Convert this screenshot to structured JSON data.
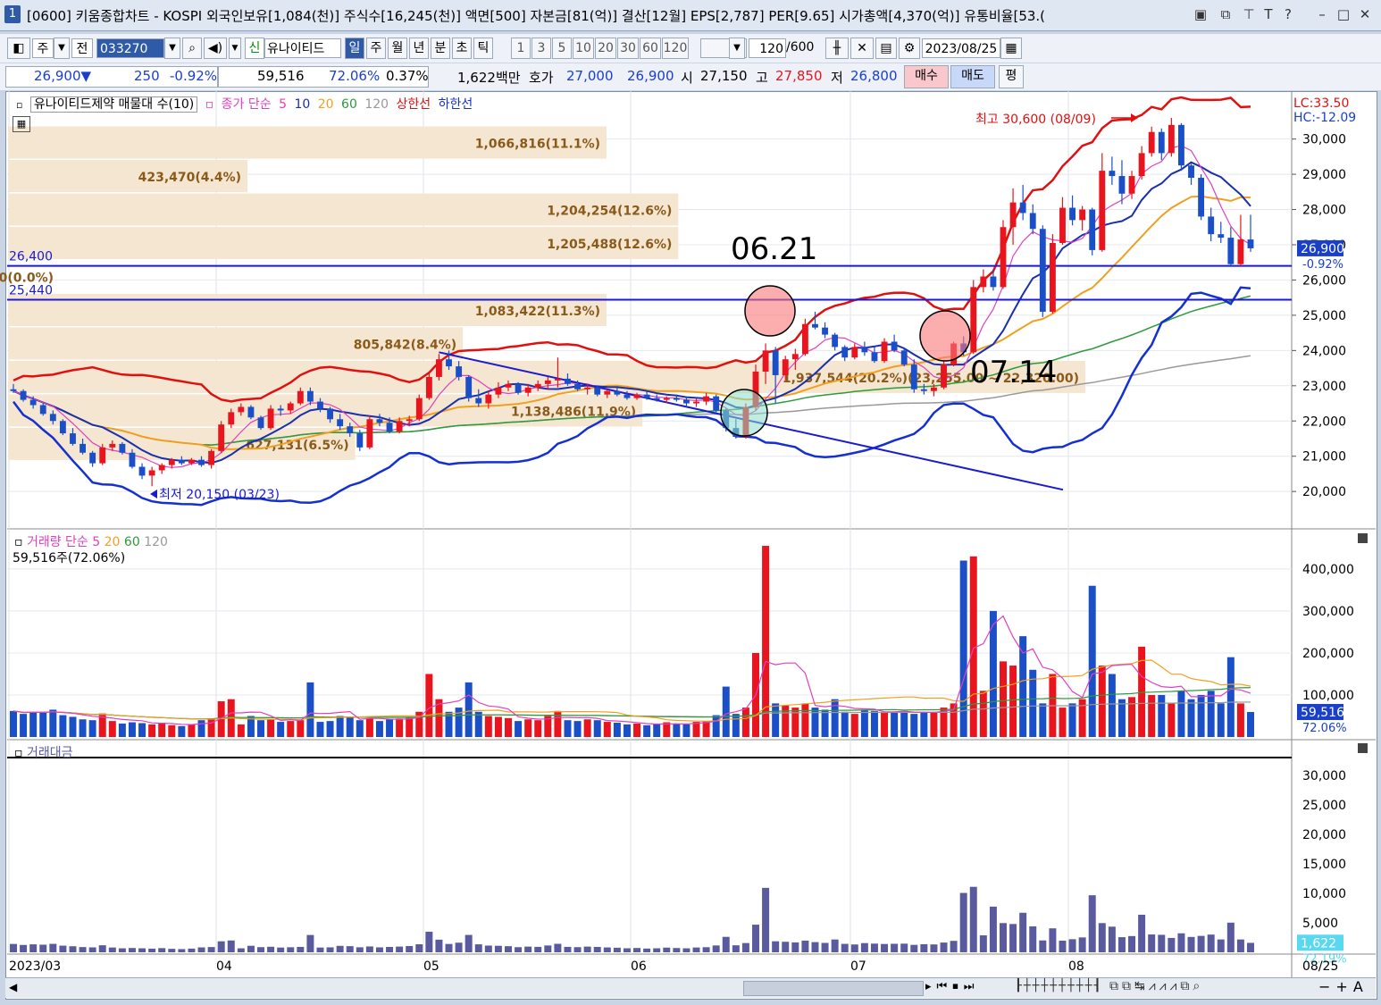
{
  "window": {
    "number": "1",
    "title": "[0600] 키움종합차트 - KOSPI 외국인보유[1,084(천)] 주식수[16,245(천)] 액면[500] 자본금[81(억)] 결산[12월] EPS[2,787] PER[9.65] 시가총액[4,370(억)] 유통비율[53.("
  },
  "toolbar": {
    "market": "주",
    "mode": "전",
    "code": "033270",
    "stock_badge": "신",
    "stock_name": "유나이티드",
    "periods": [
      "일",
      "주",
      "월",
      "년",
      "분",
      "초",
      "틱"
    ],
    "active_period": "일",
    "intervals": [
      "1",
      "3",
      "5",
      "10",
      "20",
      "30",
      "60",
      "120"
    ],
    "count": "120",
    "count_max": "/600",
    "date": "2023/08/25"
  },
  "quote": {
    "price": "26,900▼",
    "change": "250",
    "change_pct": "-0.92%",
    "volume": "59,516",
    "volume_ratio": "72.06%",
    "turnover": "0.37%",
    "amount": "1,622백만",
    "bid_label": "호가",
    "ask": "27,000",
    "bid": "26,900",
    "open_label": "시",
    "open": "27,150",
    "high_label": "고",
    "high": "27,850",
    "low_label": "저",
    "low": "26,800",
    "buy_label": "매수",
    "sell_label": "매도",
    "eval_label": "평"
  },
  "legend": {
    "price": {
      "title": "유나이티드제약 매물대 수(10)",
      "ma_label": "종가 단순",
      "ma_periods": [
        "5",
        "10",
        "20",
        "60",
        "120"
      ],
      "upper": "상한선",
      "lower": "하한선"
    },
    "volume": {
      "title": "거래량",
      "ma_label": "단순",
      "ma_periods": [
        "5",
        "20",
        "60",
        "120"
      ],
      "current": "59,516주(72.06%)"
    },
    "amount": {
      "title": "거래대금"
    }
  },
  "annotations": {
    "high": "최고 30,600 (08/09)",
    "low": "최저 20,150 (03/23)",
    "date1": "06.21",
    "date2": "07.14",
    "lc": "LC:33.50",
    "hc": "HC:-12.09"
  },
  "colors": {
    "up": "#e8141e",
    "down": "#1a4fc8",
    "ma5": "#e040c0",
    "ma10": "#1a2fb0",
    "ma20": "#f0a020",
    "ma60": "#2e9a3a",
    "ma120": "#999999",
    "upper": "#e01010",
    "lower": "#1530d0",
    "profile": "#f5e6d2",
    "amount_bar": "#5a5a9e"
  },
  "chart_data": [
    {
      "type": "candlestick",
      "title": "유나이티드제약 일봉",
      "ylim": [
        19700,
        30700
      ],
      "y_ticks": [
        "30,000",
        "29,000",
        "28,000",
        "27,000",
        "26,000",
        "25,000",
        "24,000",
        "23,000",
        "22,000",
        "21,000",
        "20,000"
      ],
      "x_ticks": [
        "2023/03",
        "04",
        "05",
        "06",
        "07",
        "08",
        "08/25"
      ],
      "last_price": "26,900",
      "last_change_pct": "-0.92%",
      "horizontal_lines": [
        {
          "label": "26,400",
          "value": 26400
        },
        {
          "label": "25,440",
          "value": 25440
        }
      ],
      "volume_profile": [
        {
          "label": "1,066,816(11.1%)",
          "price": 29.9,
          "width": 0.5
        },
        {
          "label": "423,470(4.4%)",
          "price": 28.95,
          "width": 0.2
        },
        {
          "label": "1,204,254(12.6%)",
          "price": 28.0,
          "width": 0.56
        },
        {
          "label": "1,205,488(12.6%)",
          "price": 27.05,
          "width": 0.56
        },
        {
          "label": "0(0.0%)",
          "price": 26.1,
          "width": 0.0
        },
        {
          "label": "1,083,422(11.3%)",
          "price": 25.15,
          "width": 0.5
        },
        {
          "label": "805,842(8.4%)",
          "price": 24.2,
          "width": 0.38
        },
        {
          "label": "1,937,544(20.2%)(23,255.00 ~ 22,320.00)",
          "price": 23.25,
          "width": 0.9
        },
        {
          "label": "1,138,486(11.9%)",
          "price": 22.3,
          "width": 0.53
        },
        {
          "label": "627,131(6.5%)",
          "price": 21.35,
          "width": 0.29
        }
      ],
      "candles": [
        [
          22900,
          23050,
          22800,
          22850
        ],
        [
          22850,
          22900,
          22550,
          22600
        ],
        [
          22600,
          22700,
          22350,
          22450
        ],
        [
          22450,
          22500,
          22150,
          22200
        ],
        [
          22200,
          22300,
          21900,
          22000
        ],
        [
          22000,
          22050,
          21600,
          21650
        ],
        [
          21650,
          21800,
          21300,
          21350
        ],
        [
          21350,
          21500,
          21050,
          21100
        ],
        [
          21100,
          21150,
          20700,
          20800
        ],
        [
          20800,
          21350,
          20750,
          21250
        ],
        [
          21250,
          21450,
          21150,
          21350
        ],
        [
          21350,
          21400,
          21050,
          21100
        ],
        [
          21100,
          21200,
          20650,
          20700
        ],
        [
          20700,
          20800,
          20350,
          20450
        ],
        [
          20450,
          20700,
          20150,
          20600
        ],
        [
          20600,
          20800,
          20500,
          20750
        ],
        [
          20750,
          20950,
          20650,
          20900
        ],
        [
          20900,
          21000,
          20750,
          20800
        ],
        [
          20800,
          20950,
          20750,
          20900
        ],
        [
          20900,
          21000,
          20700,
          20750
        ],
        [
          20750,
          21200,
          20650,
          21150
        ],
        [
          21150,
          22000,
          21100,
          21900
        ],
        [
          21900,
          22350,
          21800,
          22250
        ],
        [
          22250,
          22500,
          22150,
          22400
        ],
        [
          22400,
          22450,
          22050,
          22100
        ],
        [
          22100,
          22150,
          21750,
          21800
        ],
        [
          21800,
          22450,
          21750,
          22350
        ],
        [
          22350,
          22450,
          22150,
          22300
        ],
        [
          22300,
          22550,
          22200,
          22500
        ],
        [
          22500,
          22950,
          22450,
          22850
        ],
        [
          22850,
          22950,
          22450,
          22550
        ],
        [
          22550,
          22650,
          22250,
          22350
        ],
        [
          22350,
          22400,
          21950,
          22050
        ],
        [
          22050,
          22200,
          21750,
          21850
        ],
        [
          21850,
          21950,
          21550,
          21650
        ],
        [
          21650,
          21750,
          21150,
          21250
        ],
        [
          21250,
          22150,
          21200,
          22050
        ],
        [
          22050,
          22200,
          21850,
          21950
        ],
        [
          21950,
          22100,
          21650,
          21700
        ],
        [
          21700,
          22100,
          21650,
          22000
        ],
        [
          22000,
          22150,
          21850,
          22050
        ],
        [
          22050,
          22750,
          22000,
          22650
        ],
        [
          22650,
          23400,
          22600,
          23250
        ],
        [
          23250,
          23900,
          23150,
          23750
        ],
        [
          23750,
          24000,
          23450,
          23550
        ],
        [
          23550,
          23700,
          23150,
          23250
        ],
        [
          23250,
          23300,
          22550,
          22650
        ],
        [
          22650,
          22900,
          22400,
          22500
        ],
        [
          22500,
          22850,
          22350,
          22750
        ],
        [
          22750,
          23100,
          22650,
          22950
        ],
        [
          22950,
          23150,
          22850,
          23050
        ],
        [
          23050,
          23100,
          22750,
          22800
        ],
        [
          22800,
          23050,
          22700,
          22950
        ],
        [
          22950,
          23150,
          22850,
          23050
        ],
        [
          23050,
          23250,
          22900,
          23150
        ],
        [
          23150,
          23800,
          22950,
          23200
        ],
        [
          23200,
          23350,
          23000,
          23050
        ],
        [
          23050,
          23150,
          22850,
          22900
        ],
        [
          22900,
          23050,
          22750,
          22950
        ],
        [
          22950,
          23000,
          22700,
          22750
        ],
        [
          22750,
          22900,
          22650,
          22850
        ],
        [
          22850,
          22950,
          22700,
          22750
        ],
        [
          22750,
          22850,
          22600,
          22650
        ],
        [
          22650,
          22800,
          22600,
          22750
        ],
        [
          22750,
          22850,
          22600,
          22650
        ],
        [
          22650,
          22750,
          22550,
          22600
        ],
        [
          22600,
          22700,
          22500,
          22650
        ],
        [
          22650,
          22750,
          22550,
          22600
        ],
        [
          22600,
          22700,
          22400,
          22500
        ],
        [
          22500,
          22650,
          22400,
          22550
        ],
        [
          22550,
          22800,
          22450,
          22700
        ],
        [
          22700,
          22750,
          22250,
          22300
        ],
        [
          22300,
          22350,
          21700,
          21800
        ],
        [
          21800,
          22050,
          21500,
          21550
        ],
        [
          21550,
          22500,
          21500,
          22400
        ],
        [
          22400,
          23600,
          22300,
          23400
        ],
        [
          23400,
          24200,
          23050,
          24000
        ],
        [
          24000,
          24100,
          22500,
          23300
        ],
        [
          23300,
          23850,
          23150,
          23750
        ],
        [
          23750,
          24050,
          23450,
          23900
        ],
        [
          23900,
          24900,
          23850,
          24750
        ],
        [
          24750,
          25100,
          24600,
          24650
        ],
        [
          24650,
          24800,
          24350,
          24450
        ],
        [
          24450,
          24500,
          24000,
          24100
        ],
        [
          24100,
          24150,
          23700,
          23800
        ],
        [
          23800,
          24200,
          23750,
          24100
        ],
        [
          24100,
          24250,
          23850,
          23950
        ],
        [
          23950,
          24100,
          23650,
          23700
        ],
        [
          23700,
          24350,
          23650,
          24250
        ],
        [
          24250,
          24450,
          23950,
          24000
        ],
        [
          24000,
          24050,
          23550,
          23600
        ],
        [
          23600,
          23750,
          22800,
          22900
        ],
        [
          22900,
          23050,
          22750,
          22850
        ],
        [
          22850,
          23050,
          22700,
          22950
        ],
        [
          22950,
          23700,
          22900,
          23600
        ],
        [
          23600,
          24250,
          23550,
          24200
        ],
        [
          24200,
          24400,
          23850,
          23950
        ],
        [
          23950,
          26000,
          23900,
          25800
        ],
        [
          25800,
          26300,
          25650,
          26100
        ],
        [
          26100,
          26300,
          25700,
          25800
        ],
        [
          25800,
          27700,
          25750,
          27500
        ],
        [
          27500,
          28600,
          27000,
          28200
        ],
        [
          28200,
          28700,
          27700,
          27900
        ],
        [
          27900,
          28150,
          27300,
          27450
        ],
        [
          27450,
          27550,
          24950,
          25100
        ],
        [
          25100,
          27300,
          25050,
          27050
        ],
        [
          27050,
          28350,
          27000,
          28050
        ],
        [
          28050,
          28400,
          27550,
          27700
        ],
        [
          27700,
          28100,
          27400,
          28000
        ],
        [
          28000,
          28050,
          26700,
          26850
        ],
        [
          26850,
          29600,
          26800,
          29100
        ],
        [
          29100,
          29500,
          28700,
          28950
        ],
        [
          28950,
          29400,
          28150,
          28450
        ],
        [
          28450,
          29100,
          28300,
          28950
        ],
        [
          28950,
          29800,
          28850,
          29600
        ],
        [
          29600,
          30350,
          29500,
          30200
        ],
        [
          30200,
          30300,
          29400,
          29600
        ],
        [
          29600,
          30600,
          29500,
          30400
        ],
        [
          30400,
          30450,
          29100,
          29250
        ],
        [
          29250,
          29300,
          28700,
          28900
        ],
        [
          28900,
          29000,
          27700,
          27800
        ],
        [
          27800,
          28050,
          27100,
          27300
        ],
        [
          27300,
          27650,
          27050,
          27200
        ],
        [
          27200,
          27500,
          26400,
          26450
        ],
        [
          26450,
          27850,
          26400,
          27150
        ],
        [
          27150,
          27850,
          26800,
          26900
        ]
      ]
    },
    {
      "type": "bar",
      "title": "거래량",
      "ylim": [
        0,
        470000
      ],
      "y_ticks": [
        "400,000",
        "300,000",
        "200,000",
        "100,000"
      ],
      "last": "59,516",
      "last_pct": "72.06%",
      "values": [
        62000,
        55000,
        60000,
        58000,
        65000,
        52000,
        48000,
        42000,
        40000,
        56000,
        38000,
        32000,
        35000,
        33000,
        30000,
        34000,
        28000,
        26000,
        30000,
        40000,
        42000,
        85000,
        90000,
        30000,
        50000,
        40000,
        42000,
        36000,
        38000,
        40000,
        130000,
        36000,
        38000,
        50000,
        48000,
        40000,
        45000,
        38000,
        42000,
        44000,
        48000,
        60000,
        150000,
        90000,
        60000,
        70000,
        130000,
        60000,
        50000,
        48000,
        45000,
        38000,
        42000,
        40000,
        50000,
        62000,
        40000,
        38000,
        42000,
        40000,
        36000,
        34000,
        30000,
        32000,
        28000,
        30000,
        35000,
        32000,
        30000,
        36000,
        38000,
        52000,
        120000,
        55000,
        70000,
        200000,
        455000,
        80000,
        75000,
        70000,
        80000,
        70000,
        65000,
        90000,
        60000,
        55000,
        65000,
        62000,
        58000,
        60000,
        62000,
        55000,
        60000,
        58000,
        70000,
        80000,
        420000,
        430000,
        110000,
        300000,
        180000,
        170000,
        240000,
        160000,
        80000,
        150000,
        70000,
        80000,
        90000,
        360000,
        170000,
        150000,
        90000,
        95000,
        215000,
        100000,
        100000,
        80000,
        110000,
        90000,
        100000,
        110000,
        80000,
        190000,
        80000,
        59516
      ],
      "series": [
        {
          "name": "단순 5"
        },
        {
          "name": "20"
        },
        {
          "name": "60"
        },
        {
          "name": "120"
        }
      ]
    },
    {
      "type": "bar",
      "title": "거래대금",
      "ylim": [
        0,
        33000
      ],
      "y_ticks": [
        "30,000",
        "25,000",
        "20,000",
        "15,000",
        "10,000",
        "5,000"
      ],
      "last": "1,622",
      "last_pct": "72.19%"
    }
  ]
}
